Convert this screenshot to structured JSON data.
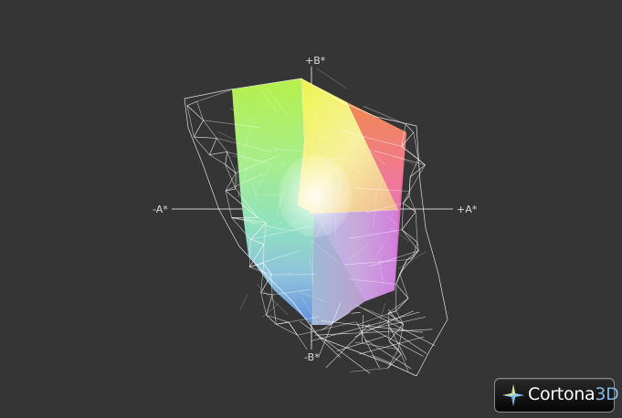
{
  "viewer": {
    "axes": {
      "plus_b": "+B*",
      "minus_b": "-B*",
      "minus_a": "-A*",
      "plus_a": "+A*"
    },
    "background_color": "#353535",
    "wireframe_color": "#ffffff"
  },
  "badge": {
    "brand": "Cortona",
    "brand_suffix": "3D"
  }
}
